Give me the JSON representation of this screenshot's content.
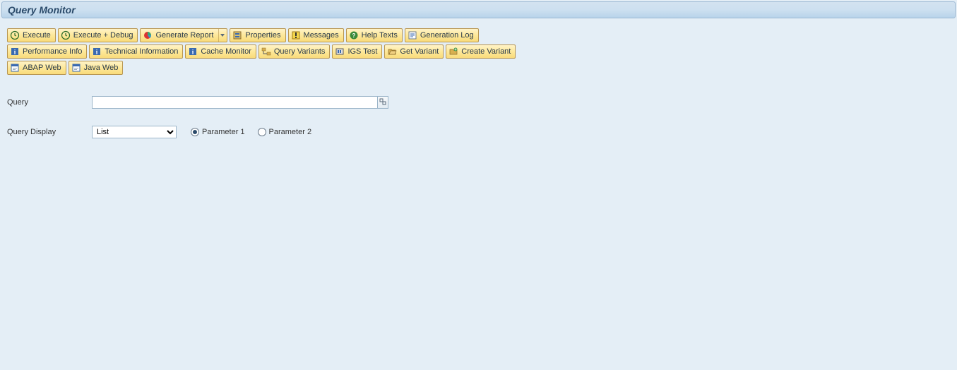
{
  "header": {
    "title": "Query Monitor"
  },
  "toolbar": {
    "row1": {
      "execute": "Execute",
      "execute_debug": "Execute + Debug",
      "generate_report": "Generate Report",
      "properties": "Properties",
      "messages": "Messages",
      "help_texts": "Help Texts",
      "generation_log": "Generation Log"
    },
    "row2": {
      "performance_info": "Performance Info",
      "technical_info": "Technical Information",
      "cache_monitor": "Cache Monitor",
      "query_variants": "Query Variants",
      "igs_test": "IGS Test",
      "get_variant": "Get Variant",
      "create_variant": "Create Variant"
    },
    "row3": {
      "abap_web": "ABAP Web",
      "java_web": "Java Web"
    }
  },
  "form": {
    "query_label": "Query",
    "query_value": "",
    "display_label": "Query Display",
    "display_value": "List",
    "param1_label": "Parameter 1",
    "param2_label": "Parameter 2",
    "param_selected": "param1"
  }
}
